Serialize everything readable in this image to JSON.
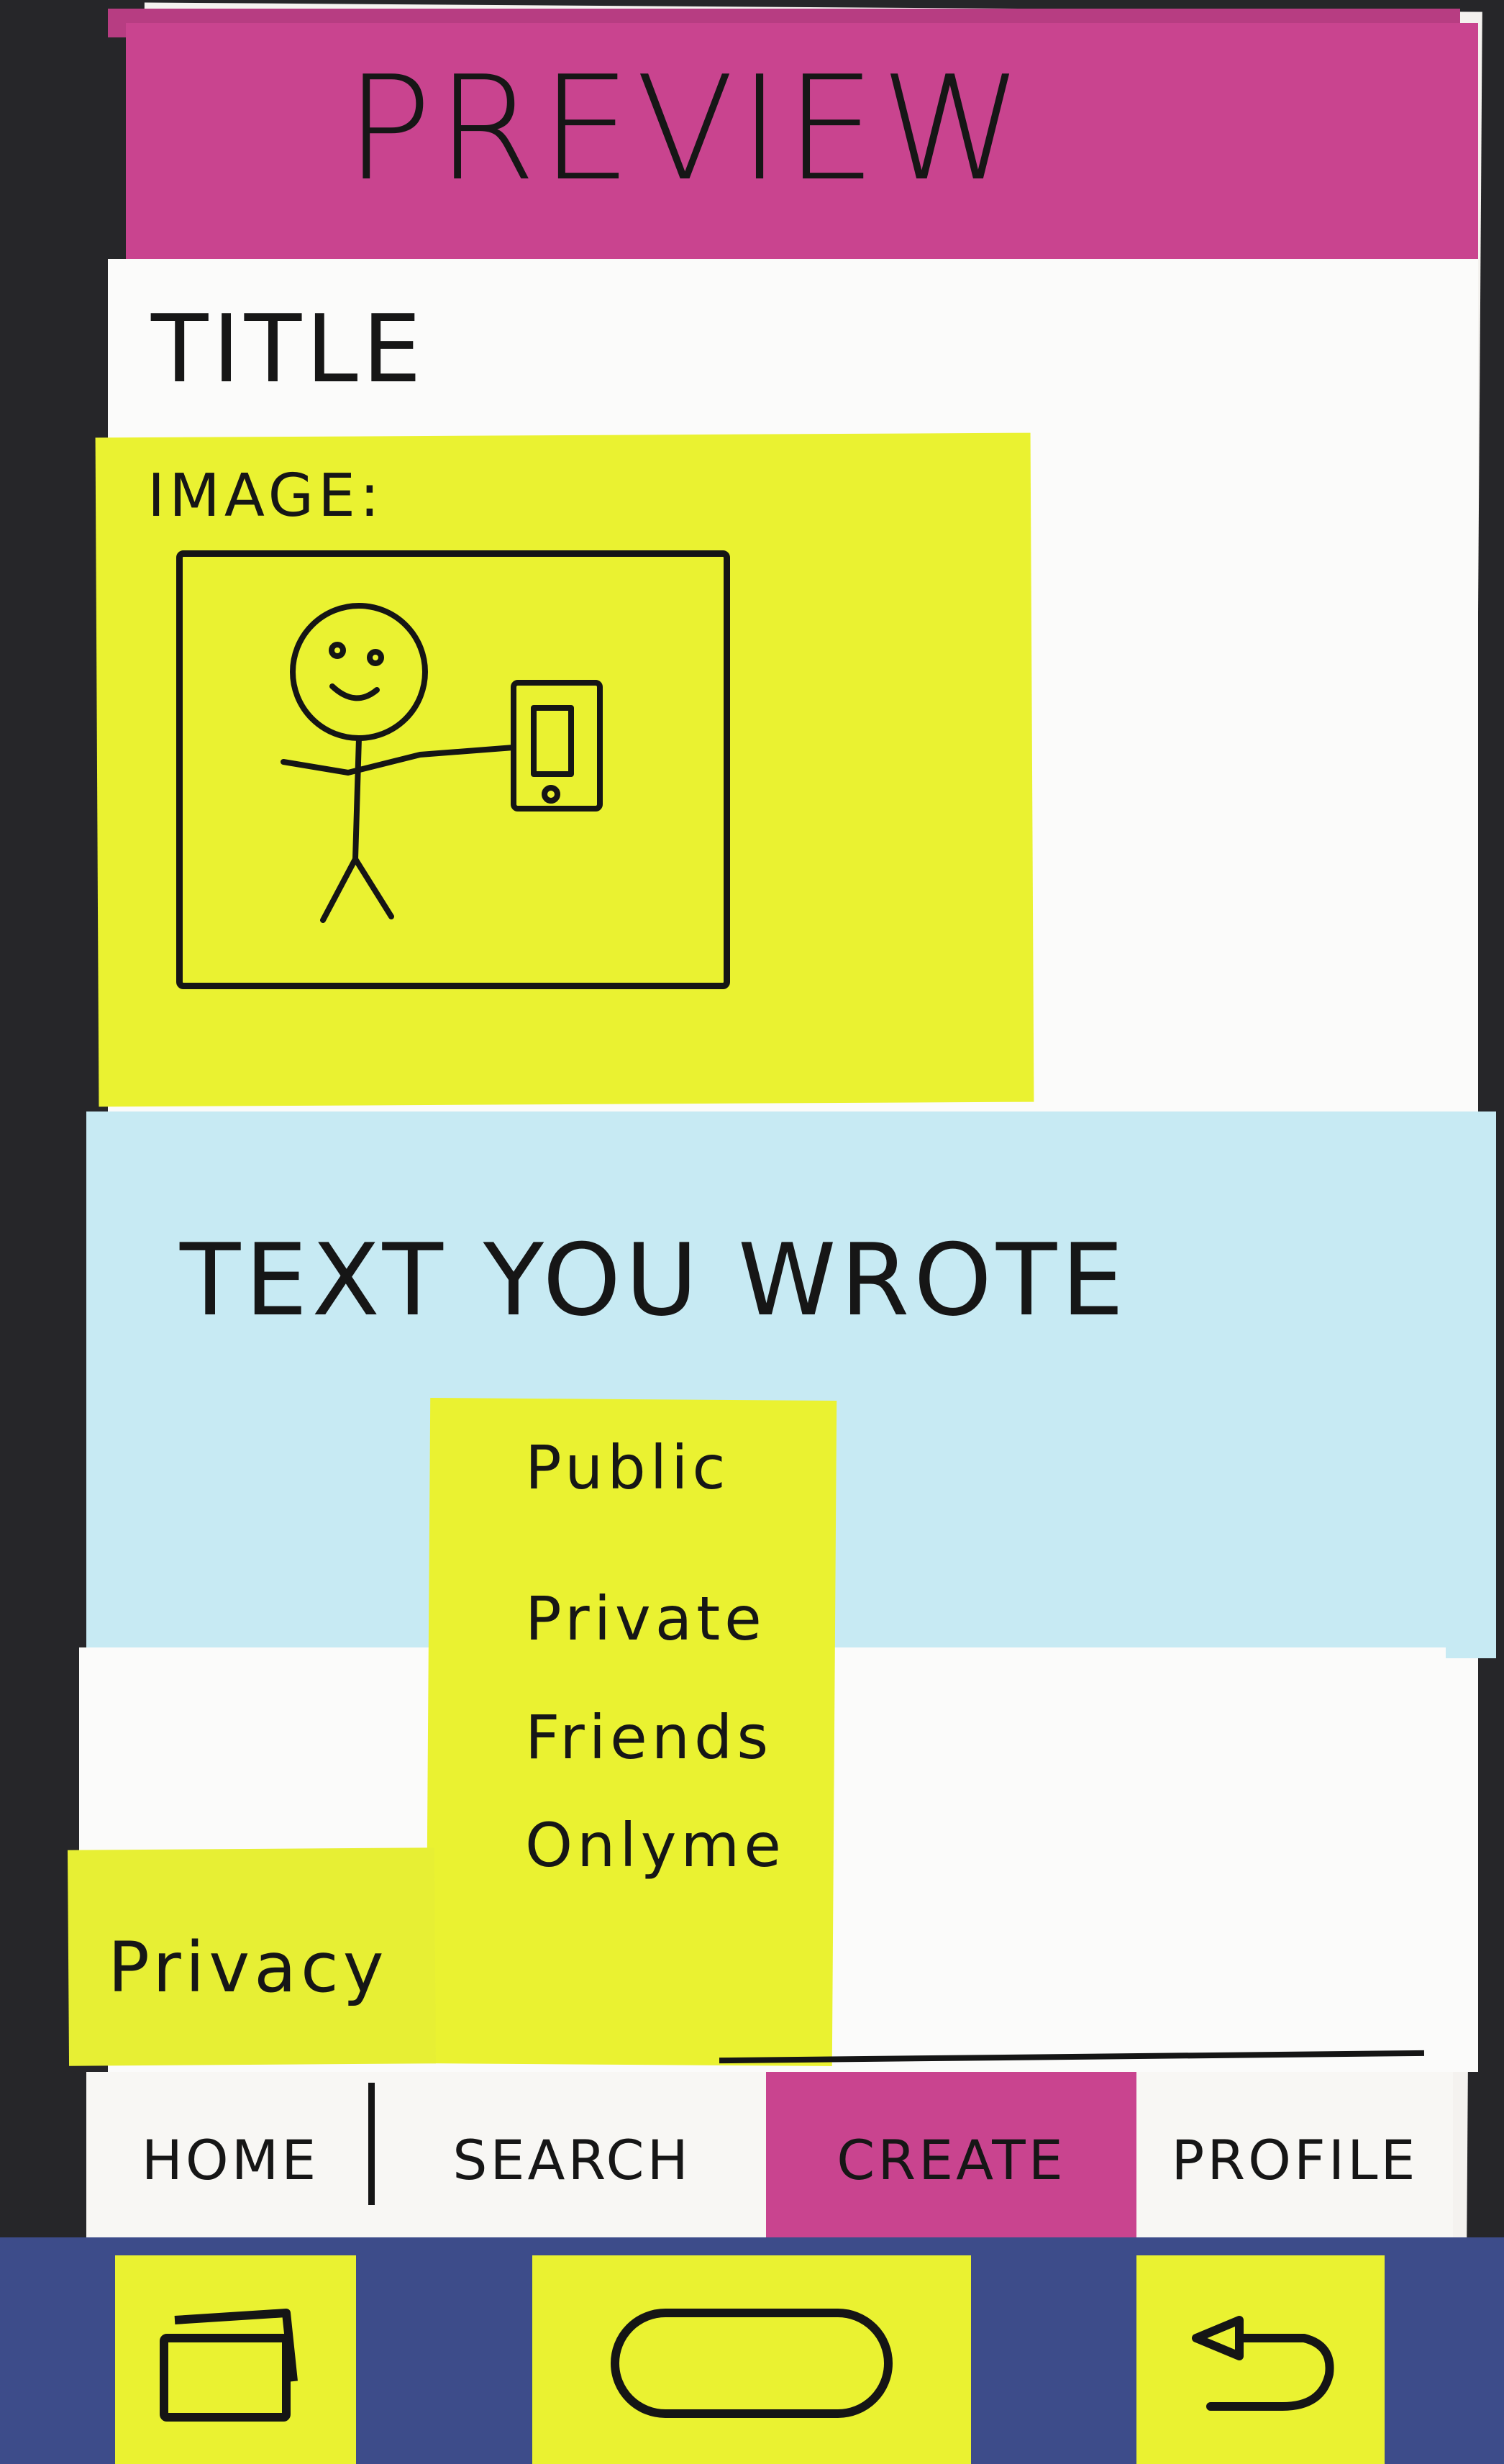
{
  "header": {
    "title": "PREVIEW"
  },
  "post": {
    "title_label": "TITLE",
    "image_label": "IMAGE:",
    "text_content": "TEXT YOU WROTE"
  },
  "privacy": {
    "label": "Privacy",
    "options": [
      "Public",
      "Private",
      "Friends",
      "Onlyme"
    ]
  },
  "tabbar": {
    "tabs": [
      {
        "label": "HOME"
      },
      {
        "label": "SEARCH"
      },
      {
        "label": "CREATE",
        "active": true
      },
      {
        "label": "PROFILE"
      }
    ]
  },
  "navbar": {
    "icons": [
      "recents-icon",
      "home-icon",
      "back-icon"
    ]
  },
  "colors": {
    "header": "#c9448f",
    "sticky_yellow": "#eaf231",
    "text_block": "#c7eaf3",
    "navbar": "#3d4c8a"
  }
}
